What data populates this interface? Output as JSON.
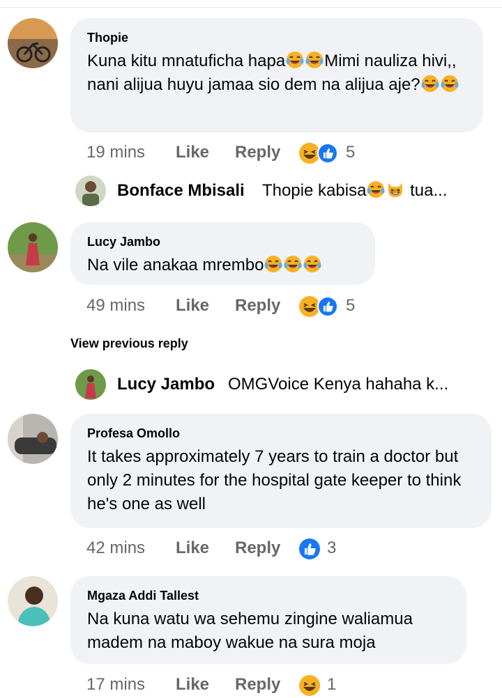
{
  "comments": [
    {
      "author": "Thopie",
      "text_parts": [
        "Kuna kitu mnatuficha hapa",
        "Mimi nauliza hivi,, nani alijua huyu jamaa sio dem na alijua aje?"
      ],
      "time": "19 mins",
      "like_label": "Like",
      "reply_label": "Reply",
      "reaction_count": "5",
      "reactions": [
        "laughing-face",
        "thumbs-up"
      ]
    },
    {
      "author": "Lucy Jambo",
      "text": "Na vile anakaa mrembo",
      "time": "49 mins",
      "like_label": "Like",
      "reply_label": "Reply",
      "reaction_count": "5",
      "reactions": [
        "laughing-face",
        "thumbs-up"
      ]
    },
    {
      "author": "Profesa Omollo",
      "text": "It takes approximately 7 years to train a doctor but only 2 minutes for the hospital gate keeper to think he's one as well",
      "time": "42 mins",
      "like_label": "Like",
      "reply_label": "Reply",
      "reaction_count": "3",
      "reactions": [
        "thumbs-up"
      ]
    },
    {
      "author": "Mgaza Addi Tallest",
      "text": "Na kuna watu wa sehemu zingine waliamua madem na maboy wakue na sura moja",
      "time": "17 mins",
      "like_label": "Like",
      "reply_label": "Reply",
      "reaction_count": "1",
      "reactions": [
        "laughing-face"
      ]
    }
  ],
  "replies": [
    {
      "author": "Bonface Mbisali",
      "text_start": "Thopie kabisa",
      "text_end": "tua..."
    },
    {
      "author": "Lucy Jambo",
      "text": "OMGVoice Kenya hahaha k..."
    }
  ],
  "view_previous_reply": "View previous reply",
  "colors": {
    "bubble": "#f0f2f5",
    "meta": "#65676b",
    "like_blue": "#1877f2",
    "emoji_yellow": "#f7b125"
  }
}
